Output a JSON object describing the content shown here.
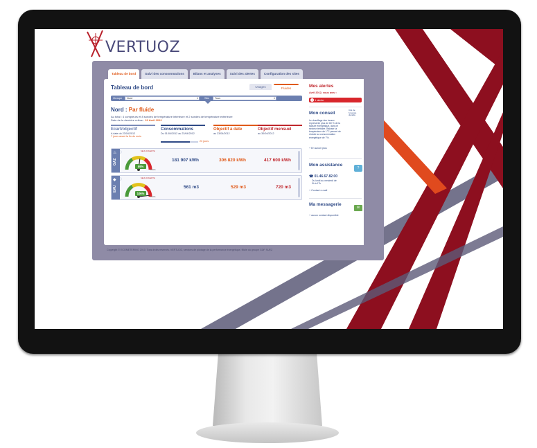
{
  "brand": {
    "logo_text": "VERTUOZ"
  },
  "tabs": [
    {
      "label": "Tableau de bord"
    },
    {
      "label": "Suivi des consommations"
    },
    {
      "label": "Bilans et analyses"
    },
    {
      "label": "Suivi des alertes"
    },
    {
      "label": "Configuration des sites"
    }
  ],
  "dashboard": {
    "title": "Tableau de bord",
    "view_usage": "Usages",
    "view_fluid": "Fluides",
    "filters": {
      "group_label": "Groupe",
      "group_value": "Nord",
      "site_label": "Site",
      "site_value": "Tous"
    },
    "site_heading": "Nord",
    "site_sep": " : ",
    "site_mode": "Par fluide",
    "info_line1": "Au total : 4 compteurs et 8 sondes de température intérieure et 2 sondes de température extérieure",
    "info_line2_prefix": "Date de la dernière relève :",
    "info_line2_date": "22 Avril 2012",
    "columns": {
      "ecart": {
        "title": "Ecart/objectif",
        "sub": "A date du 23/04/2012",
        "sub2": "7 jours avant la fin du mois"
      },
      "cons": {
        "title": "Consommations",
        "sub": "Du 01/04/2012 au 23/04/2012",
        "progress_label": "23 jours",
        "progress_fraction": 0.77
      },
      "objd": {
        "title": "Objectif à date",
        "sub": "au 23/04/2012"
      },
      "objm": {
        "title": "Objectif mensuel",
        "sub": "au 30/04/2012"
      }
    },
    "rows": [
      {
        "fluid": "GAZ",
        "gauge_pct": "59%",
        "gauge_level": 0.59,
        "gauge_header": "SEUIL D'ALERTE",
        "gauge_end": "100%",
        "consumption": "181 907 kWh",
        "objective_date": "306 820 kWh",
        "objective_month": "417 600 kWh"
      },
      {
        "fluid": "EAU",
        "gauge_pct": "106%",
        "gauge_level": 1.06,
        "gauge_header": "SEUIL D'ALERTE",
        "gauge_end": "110%",
        "consumption": "561 m3",
        "objective_date": "529 m3",
        "objective_month": "720 m3"
      }
    ],
    "footer": "Copyright © ECOMETERING 2010. Tous droits réservés. VERTUOZ, services de pilotage de la performance énergétique, filiale du groupe GDF SUEZ"
  },
  "sidebar": {
    "alerts_title": "Mes alertes",
    "alerts_sub": "Avril 2012, vous avez :",
    "alerts_button": "1 alerte",
    "conseil_title": "Mon conseil",
    "conseil_logo": "Cité de l'énergie durable",
    "conseil_text": "Le chauffage des locaux représente plus de 60 % de la facture énergétique, dans le secteur tertiaire. Baisser la température de 1°C permet de réduire sa consommation énergétique de 7%.",
    "conseil_link": "+ En savoir plus",
    "assist_title": "Mon assistance",
    "assist_phone": "01.46.67.82.00",
    "assist_hours": "Du lundi au vendredi de 9h à 17h",
    "assist_link": "+ Contact e-mail",
    "messages_title": "Ma messagerie",
    "messages_text": "+ aucun contact disponible"
  },
  "colors": {
    "brand_blue": "#2f4a86",
    "accent_orange": "#e05a1a",
    "alert_red": "#c0272d",
    "deco_maroon": "#8d0f1f",
    "deco_slate": "#5c5a78"
  }
}
